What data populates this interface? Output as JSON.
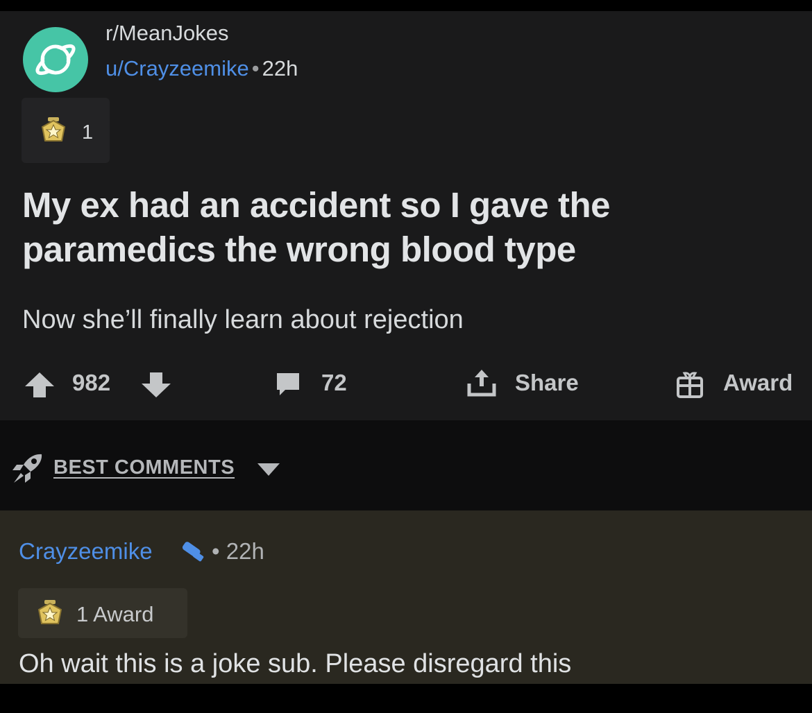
{
  "post": {
    "subreddit": "r/MeanJokes",
    "author": "u/Crayzeemike",
    "separator": "•",
    "age": "22h",
    "award_count": "1",
    "title": "My ex had an accident so I gave the paramedics the wrong blood type",
    "body": "Now she’ll finally learn about rejection",
    "score": "982",
    "comment_count": "72",
    "share_label": "Share",
    "award_label": "Award"
  },
  "sort": {
    "label": "BEST COMMENTS"
  },
  "comment": {
    "author": "Crayzeemike",
    "separator": "•",
    "age": "22h",
    "award_label": "1 Award",
    "body": "Oh wait this is a joke sub. Please disregard this"
  },
  "colors": {
    "background": "#000000",
    "card": "#1a1a1b",
    "link_blue": "#4f8fe6",
    "subreddit_teal": "#46c5a6",
    "highlighted_comment": "#2a2820"
  },
  "icons": {
    "subreddit_avatar": "planet-icon",
    "award": "medal-star-icon",
    "upvote": "arrow-up-icon",
    "downvote": "arrow-down-icon",
    "comments": "speech-bubble-icon",
    "share": "share-upload-icon",
    "give_award": "gift-icon",
    "sort": "rocket-icon",
    "sort_toggle": "caret-down-icon",
    "mod_badge": "wrench-icon"
  }
}
